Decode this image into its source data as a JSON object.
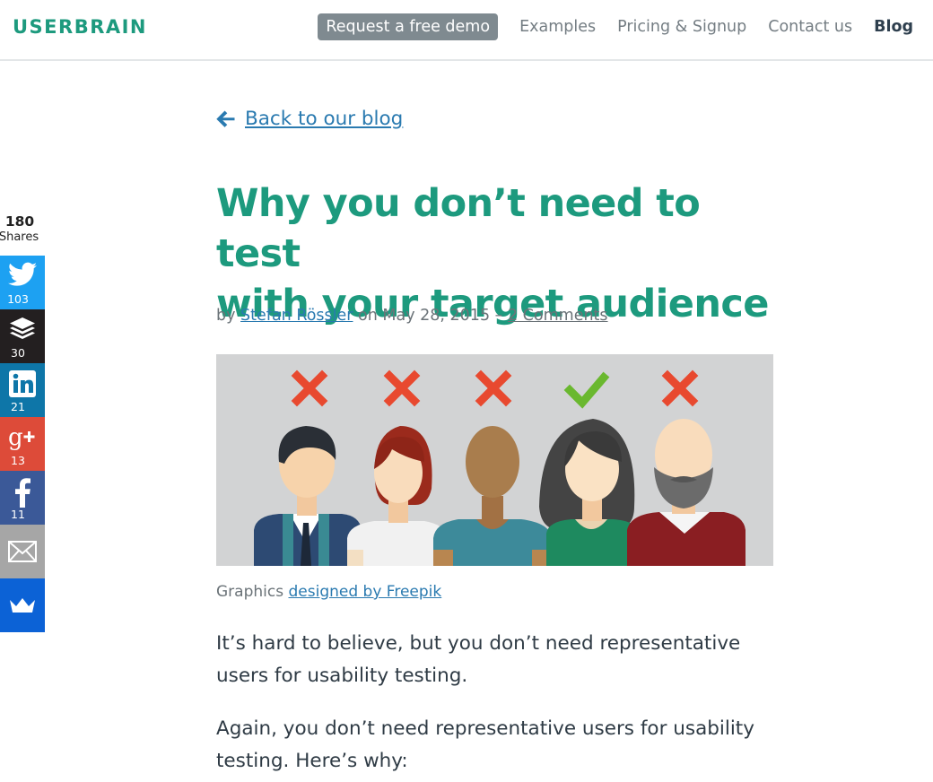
{
  "header": {
    "logo": "USERBRAIN",
    "nav": {
      "demo": "Request a free demo",
      "examples": "Examples",
      "pricing": "Pricing & Signup",
      "contact": "Contact us",
      "blog": "Blog"
    }
  },
  "share": {
    "total": "180",
    "total_label": "Shares",
    "buttons": [
      {
        "network": "twitter",
        "icon": "twitter-bird-icon",
        "count": "103",
        "color": "#1da1f2"
      },
      {
        "network": "buffer",
        "icon": "buffer-stack-icon",
        "count": "30",
        "color": "#231f20"
      },
      {
        "network": "linkedin",
        "icon": "linkedin-icon",
        "count": "21",
        "color": "#0e76a8"
      },
      {
        "network": "google-plus",
        "icon": "google-plus-icon",
        "count": "13",
        "color": "#dd4b39"
      },
      {
        "network": "facebook",
        "icon": "facebook-icon",
        "count": "11",
        "color": "#3b5998"
      },
      {
        "network": "email",
        "icon": "envelope-icon",
        "count": "",
        "color": "#a6a6a6"
      },
      {
        "network": "sumome",
        "icon": "crown-icon",
        "count": "",
        "color": "#0c62d6"
      }
    ]
  },
  "article": {
    "back_link": "Back to our blog",
    "title_line1": "Why you don’t need to test",
    "title_line2": "with your target audience",
    "byline": {
      "by": "by",
      "author": "Stefan Rössler",
      "date_text": "on May 28, 2015 –",
      "comments": "2 Comments"
    },
    "image_caption": {
      "prefix": "Graphics",
      "credit": "designed by Freepik"
    },
    "paragraphs": [
      "It’s hard to believe, but you don’t need representative users for usability testing.",
      "Again, you don’t need representative users for usability testing. Here’s why:"
    ]
  },
  "colors": {
    "accent_green": "#1d9a7e",
    "link_blue": "#2a7ab0",
    "reject_red": "#e8492f",
    "approve_green": "#6ab82f"
  }
}
